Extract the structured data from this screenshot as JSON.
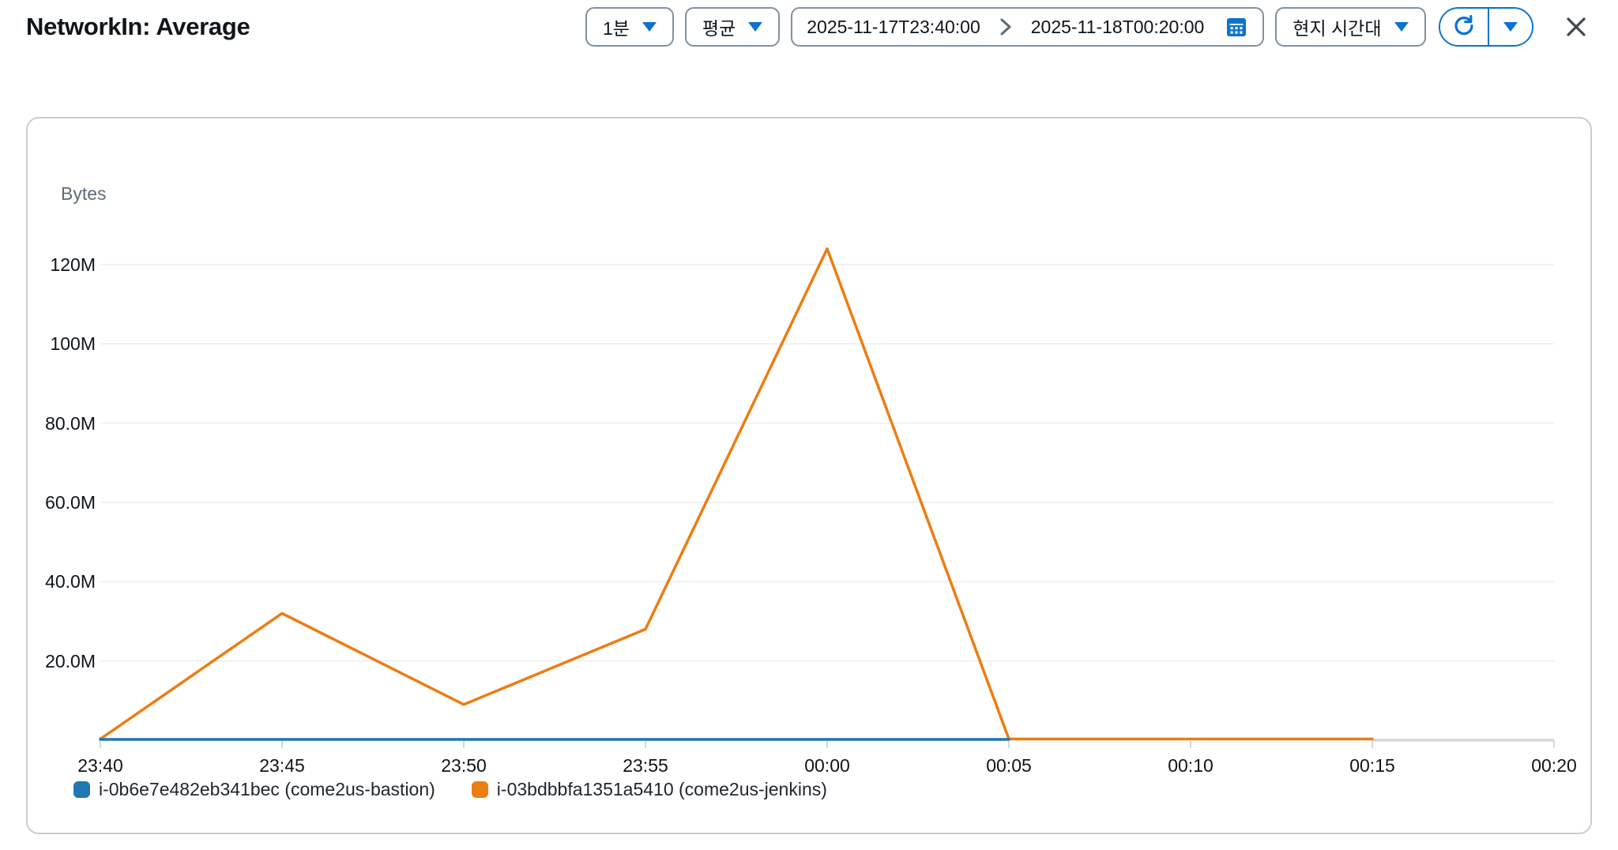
{
  "header": {
    "title": "NetworkIn: Average",
    "period": {
      "label": "1분"
    },
    "statistic": {
      "label": "평균"
    },
    "date_range": {
      "start": "2025-11-17T23:40:00",
      "end": "2025-11-18T00:20:00"
    },
    "timezone": {
      "label": "현지 시간대"
    }
  },
  "colors": {
    "accent_blue": "#0972d3",
    "muted_gray": "#5f6b7a",
    "close_icon": "#424650",
    "grid_line": "#eceef1",
    "axis_line": "#d2d7dd",
    "card_border": "#c8cdd5"
  },
  "chart_data": {
    "type": "line",
    "title": "NetworkIn: Average",
    "ylabel": "Bytes",
    "x_axis": "time (1-minute period, shown 23:40 → 00:20)",
    "x_tick_minutes": [
      0,
      5,
      10,
      15,
      20,
      25,
      30,
      35,
      40
    ],
    "x_tick_labels": [
      "23:40",
      "23:45",
      "23:50",
      "23:55",
      "00:00",
      "00:05",
      "00:10",
      "00:15",
      "00:20"
    ],
    "y_tick_values_m": [
      20,
      40,
      60,
      80,
      100,
      120
    ],
    "y_tick_labels": [
      "20.0M",
      "40.0M",
      "60.0M",
      "80.0M",
      "100M",
      "120M"
    ],
    "ylim_m": [
      0,
      130
    ],
    "grid": "horizontal-only",
    "legend_position": "bottom-left",
    "series": [
      {
        "name": "i-0b6e7e482eb341bec (come2us-bastion)",
        "color": "#1f77b4",
        "x_minutes": [
          0,
          5,
          10,
          15,
          20,
          25
        ],
        "values_mbytes": [
          0.2,
          0.2,
          0.2,
          0.2,
          0.2,
          0.2
        ]
      },
      {
        "name": "i-03bdbbfa1351a5410 (come2us-jenkins)",
        "color": "#ec7d11",
        "x_minutes": [
          0,
          5,
          10,
          15,
          20,
          25,
          30,
          35
        ],
        "values_mbytes": [
          0.3,
          32,
          9,
          28,
          124,
          0.3,
          0.3,
          0.3
        ]
      }
    ],
    "no_data_axis_segment_minutes": [
      35,
      40
    ]
  }
}
